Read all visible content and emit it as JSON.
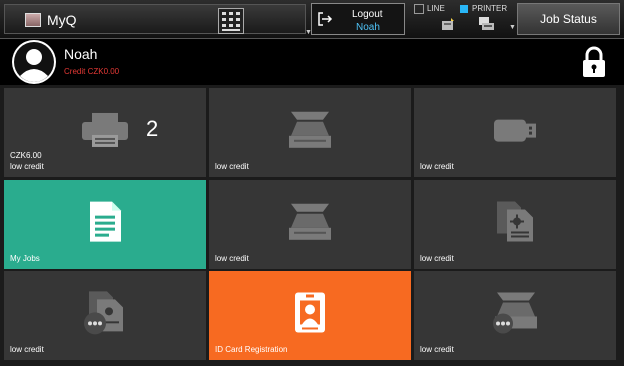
{
  "header": {
    "app_title": "MyQ",
    "logout_label": "Logout",
    "logout_user": "Noah",
    "line_label": "LINE",
    "printer_label": "PRINTER",
    "job_status_label": "Job Status"
  },
  "user": {
    "name": "Noah",
    "credit": "Credit CZK0.00"
  },
  "tiles": [
    {
      "icon": "printer-icon",
      "badge": "2",
      "value": "CZK6.00",
      "label": "low credit"
    },
    {
      "icon": "scanner-icon",
      "label": "low credit"
    },
    {
      "icon": "usb-drive-icon",
      "label": "low credit"
    },
    {
      "icon": "document-icon",
      "label": "My Jobs",
      "color": "#2aac8e"
    },
    {
      "icon": "scanner-icon",
      "label": "low credit"
    },
    {
      "icon": "copy-document-icon",
      "label": "low credit"
    },
    {
      "icon": "document-more-icon",
      "label": "low credit"
    },
    {
      "icon": "id-card-icon",
      "label": "ID Card Registration",
      "color": "#f76a21"
    },
    {
      "icon": "scanner-more-icon",
      "label": "low credit"
    }
  ],
  "colors": {
    "accent_blue": "#4fc3f7",
    "credit_red": "#e53935",
    "tile_gray": "#363636"
  }
}
